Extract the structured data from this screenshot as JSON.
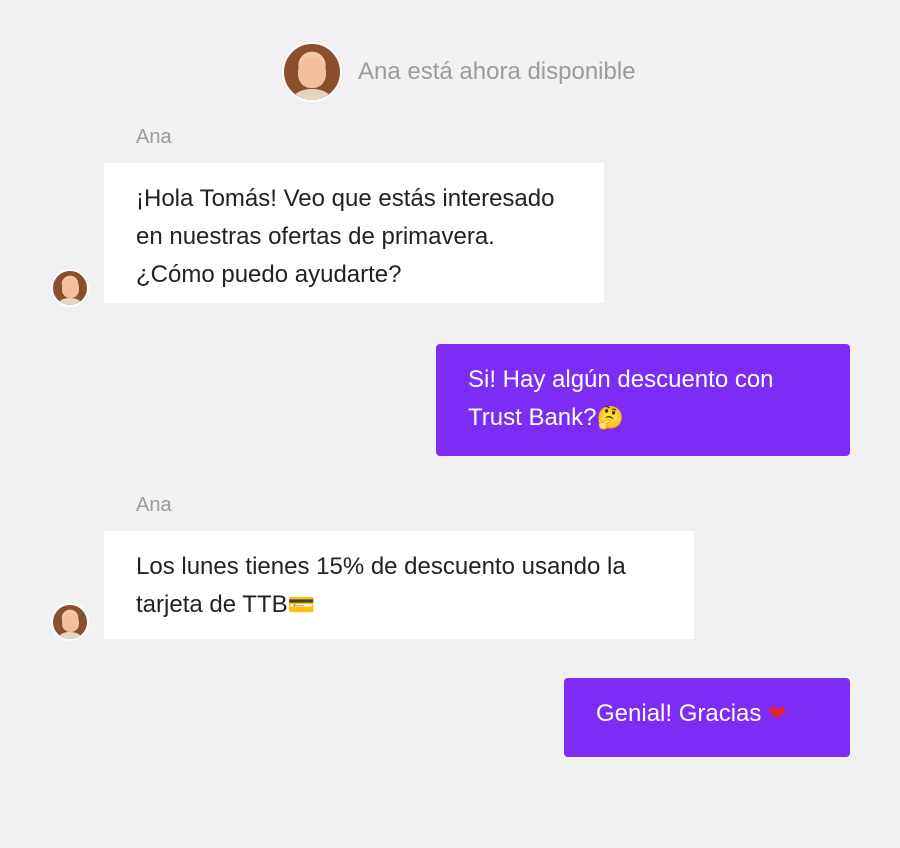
{
  "header": {
    "status_text": "Ana está ahora disponible"
  },
  "messages": [
    {
      "from": "Ana",
      "direction": "incoming",
      "text": "¡Hola Tomás! Veo que estás interesado en nuestras ofertas de primavera. ¿Cómo puedo ayudarte?"
    },
    {
      "direction": "outgoing",
      "text": "Si! Hay algún descuento con Trust Bank?",
      "emoji": "🤔"
    },
    {
      "from": "Ana",
      "direction": "incoming",
      "text": "Los lunes tienes 15% de descuento usando la tarjeta de TTB",
      "emoji": "💳"
    },
    {
      "direction": "outgoing",
      "text": "Genial! Gracias",
      "emoji": "❤"
    }
  ],
  "colors": {
    "background": "#f1f1f1",
    "incoming_bubble": "#ffffff",
    "outgoing_bubble": "#7c2cf5",
    "muted_text": "#9c9c9c"
  }
}
